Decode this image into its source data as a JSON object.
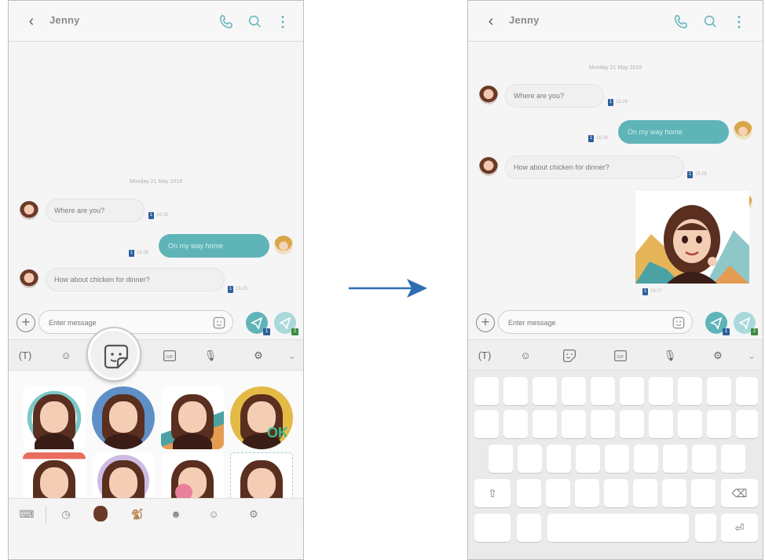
{
  "colors": {
    "accent": "#5fb4b8",
    "sim_badge": "#2f5f9c",
    "arrow": "#2f6db1",
    "incoming_bubble": "#f0f0f0"
  },
  "conversation": {
    "contact_name": "Jenny",
    "date_divider": "Monday 21 May 2018",
    "messages": [
      {
        "direction": "incoming",
        "text": "Where are you?",
        "time": "16:26"
      },
      {
        "direction": "outgoing",
        "text": "On my way home",
        "time": "16:26"
      },
      {
        "direction": "incoming",
        "text": "How about chicken for dinner?",
        "time": "16:26"
      }
    ],
    "sticker_message": {
      "direction": "outgoing",
      "time": "16:27"
    }
  },
  "input": {
    "placeholder": "Enter message",
    "sim1_label": "1",
    "sim2_label": "2"
  },
  "toolbar_icons": [
    "text-mode-icon",
    "emoji-icon",
    "sticker-icon",
    "gif-icon",
    "microphone-icon",
    "settings-icon",
    "chevron-down-icon"
  ],
  "sticker_categories": [
    "keyboard-icon",
    "recent-icon",
    "my-emoji-icon",
    "animal-sticker-icon",
    "face-sticker-icon",
    "character-sticker-icon",
    "settings-icon"
  ],
  "sticker_grid": [
    "swirl",
    "wink",
    "sunglasses",
    "ok",
    "balloons",
    "heart",
    "gum-bubble",
    "frame"
  ],
  "sticker_ok_text": "OK",
  "keyboard": {
    "shift_glyph": "⇧",
    "backspace_glyph": "⌫",
    "enter_glyph": "⏎"
  }
}
